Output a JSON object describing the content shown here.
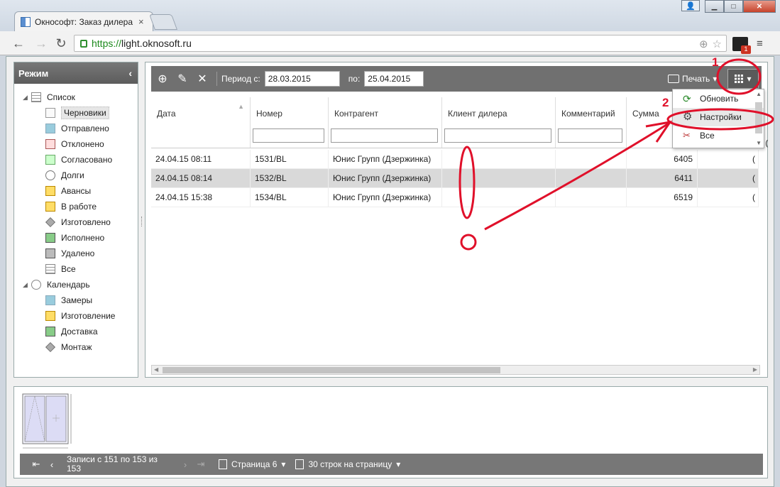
{
  "browser": {
    "tab_title": "Окнософт: Заказ дилера",
    "tab_close": "×",
    "url_https": "https://",
    "url_rest": "light.oknosoft.ru",
    "window_minimize": "▁",
    "window_maximize": "□",
    "window_close": "✕",
    "ext_badge": "1"
  },
  "sidebar": {
    "title": "Режим",
    "collapse_glyph": "‹",
    "groups": [
      {
        "label": "Список",
        "items": [
          "Черновики",
          "Отправлено",
          "Отклонено",
          "Согласовано",
          "Долги",
          "Авансы",
          "В работе",
          "Изготовлено",
          "Исполнено",
          "Удалено",
          "Все"
        ]
      },
      {
        "label": "Календарь",
        "items": [
          "Замеры",
          "Изготовление",
          "Доставка",
          "Монтаж"
        ]
      }
    ]
  },
  "toolbar": {
    "period_from_label": "Период с:",
    "period_from": "28.03.2015",
    "period_to_label": "по:",
    "period_to": "25.04.2015",
    "print_label": "Печать"
  },
  "grid": {
    "columns": [
      "Дата",
      "Номер",
      "Контрагент",
      "Клиент дилера",
      "Комментарий",
      "Сумма"
    ],
    "rows": [
      {
        "date": "24.04.15 08:11",
        "number": "1531/BL",
        "partner": "Юнис Групп (Дзержинка)",
        "client": "",
        "comment": "",
        "sum": "6405",
        "extra": "("
      },
      {
        "date": "24.04.15 08:14",
        "number": "1532/BL",
        "partner": "Юнис Групп (Дзержинка)",
        "client": "",
        "comment": "",
        "sum": "6411",
        "extra": "("
      },
      {
        "date": "24.04.15 15:38",
        "number": "1534/BL",
        "partner": "Юнис Групп (Дзержинка)",
        "client": "",
        "comment": "",
        "sum": "6519",
        "extra": "("
      }
    ]
  },
  "dropdown": {
    "items": [
      "Обновить",
      "Настройки",
      "Все"
    ],
    "extra": "("
  },
  "pager": {
    "records_text": "Записи с 151 по 153 из 153",
    "page_label": "Страница 6",
    "rows_per_page": "30 строк на страницу"
  },
  "annotations": {
    "marker_1": "1",
    "marker_2": "2",
    "color": "#e0102a"
  }
}
